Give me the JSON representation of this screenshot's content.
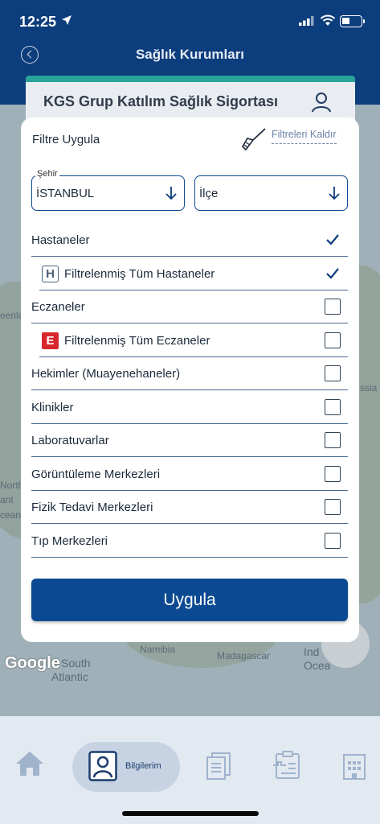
{
  "status": {
    "time": "12:25"
  },
  "header": {
    "title": "Sağlık Kurumları"
  },
  "background_card": {
    "title": "KGS Grup Katılım Sağlık Sigortası"
  },
  "map": {
    "labels": [
      "eenlan",
      "North",
      "ant",
      "cean",
      "Namibia",
      "Madagascar",
      "South",
      "Atlantic",
      "Ind",
      "Ocea",
      "ssia"
    ],
    "google": "Google"
  },
  "modal": {
    "title": "Filtre Uygula",
    "clear_label": "Filtreleri Kaldır",
    "city": {
      "label": "Şehir",
      "value": "İSTANBUL"
    },
    "district": {
      "value": "İlçe"
    },
    "rows": [
      {
        "label": "Hastaneler",
        "checked": true,
        "type": "main"
      },
      {
        "label": "Filtrelenmiş Tüm Hastaneler",
        "checked": true,
        "type": "sub",
        "badge": "H"
      },
      {
        "label": "Eczaneler",
        "checked": false,
        "type": "main"
      },
      {
        "label": "Filtrelenmiş Tüm Eczaneler",
        "checked": false,
        "type": "sub",
        "badge": "E"
      },
      {
        "label": "Hekimler (Muayenehaneler)",
        "checked": false,
        "type": "main"
      },
      {
        "label": "Klinikler",
        "checked": false,
        "type": "main"
      },
      {
        "label": "Laboratuvarlar",
        "checked": false,
        "type": "main"
      },
      {
        "label": "Görüntüleme Merkezleri",
        "checked": false,
        "type": "main"
      },
      {
        "label": "Fizik Tedavi Merkezleri",
        "checked": false,
        "type": "main"
      },
      {
        "label": "Tıp Merkezleri",
        "checked": false,
        "type": "main"
      }
    ],
    "apply_label": "Uygula"
  },
  "nav": {
    "active_label": "Bilgilerim"
  },
  "colors": {
    "primary": "#0b4a92",
    "header": "#0c3d7c",
    "accent": "#2aa39a"
  }
}
